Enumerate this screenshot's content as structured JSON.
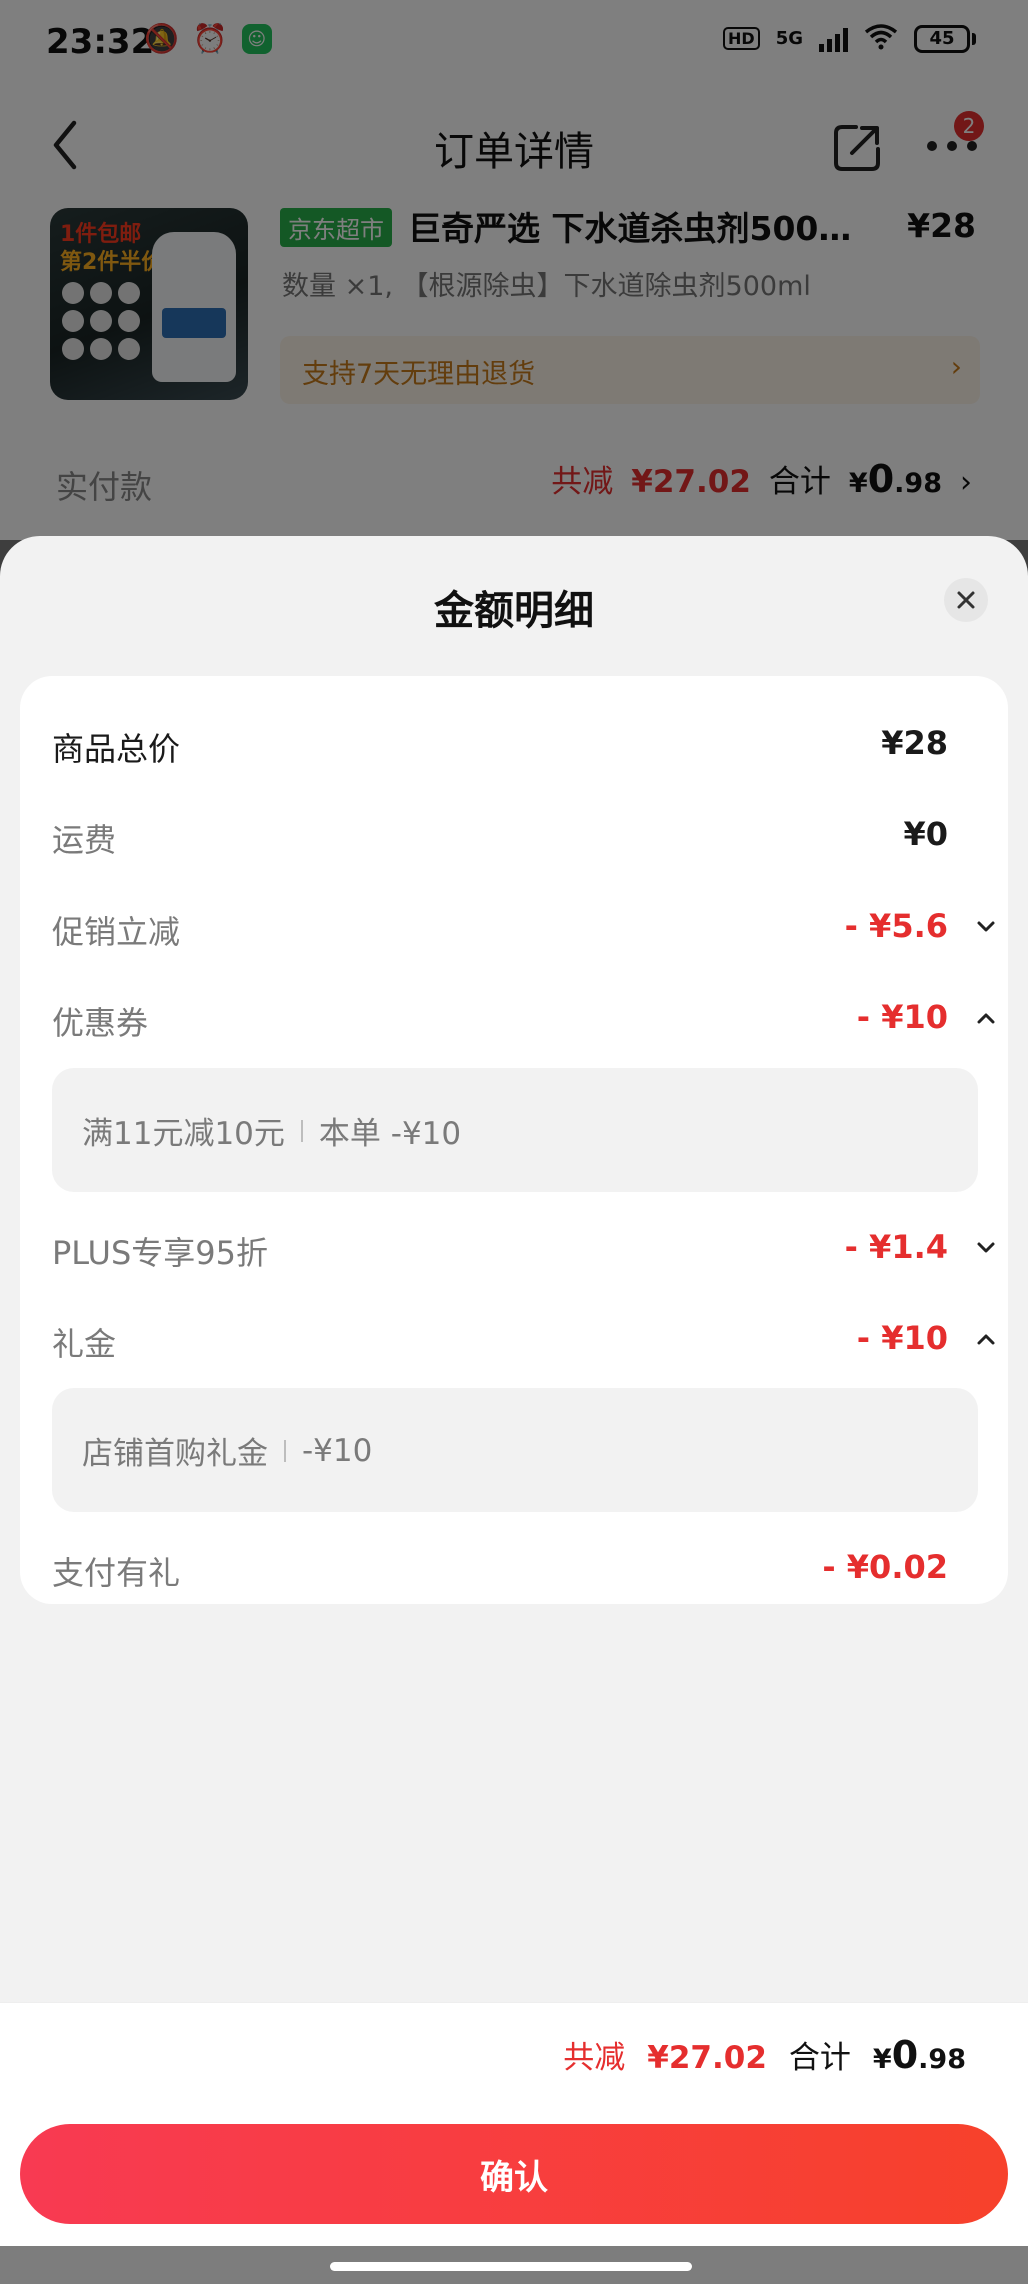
{
  "status_bar": {
    "time": "23:32",
    "network": "5G",
    "hd": "HD",
    "battery": "45"
  },
  "nav": {
    "title": "订单详情",
    "more_badge": "2"
  },
  "product": {
    "store_tag": "京东超市",
    "title": "巨奇严选 下水道杀虫剂500…",
    "price": "¥28",
    "spec": "数量 ×1, 【根源除虫】下水道除虫剂500ml",
    "return_policy": "支持7天无理由退货",
    "thumb_tag_1": "1件包邮",
    "thumb_tag_2": "第2件半价"
  },
  "paid_row": {
    "label": "实付款",
    "discount_label": "共减",
    "discount_value": "¥27.02",
    "total_label": "合计",
    "total_currency": "¥",
    "total_integer": "0",
    "total_decimal": ".98"
  },
  "sheet": {
    "title": "金额明细",
    "rows": {
      "goods_total": {
        "label": "商品总价",
        "value": "¥28"
      },
      "shipping": {
        "label": "运费",
        "value": "¥0"
      },
      "promo": {
        "label": "促销立减",
        "value": "- ¥5.6"
      },
      "coupon": {
        "label": "优惠券",
        "value": "- ¥10",
        "detail_name": "满11元减10元",
        "detail_value": "本单 -¥10"
      },
      "plus": {
        "label": "PLUS专享95折",
        "value": "- ¥1.4"
      },
      "gift": {
        "label": "礼金",
        "value": "- ¥10",
        "detail_name": "店铺首购礼金",
        "detail_value": "-¥10"
      },
      "pay_gift": {
        "label": "支付有礼",
        "value": "- ¥0.02"
      }
    }
  },
  "footer": {
    "discount_label": "共减",
    "discount_value": "¥27.02",
    "total_label": "合计",
    "total_currency": "¥",
    "total_integer": "0",
    "total_decimal": ".98",
    "confirm_label": "确认"
  },
  "colors": {
    "accent_red": "#e52e2e",
    "store_green": "#29b14b",
    "confirm_gradient_start": "#f83a52",
    "confirm_gradient_end": "#f7412b"
  }
}
